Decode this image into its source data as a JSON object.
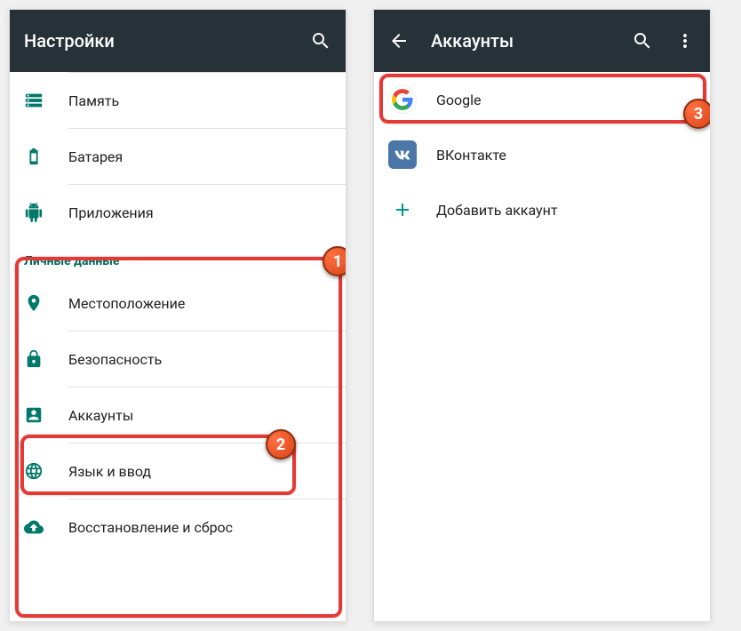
{
  "left": {
    "title": "Настройки",
    "items_top": [
      {
        "label": "Память",
        "icon": "storage"
      },
      {
        "label": "Батарея",
        "icon": "battery"
      },
      {
        "label": "Приложения",
        "icon": "apps"
      }
    ],
    "section_header": "Личные данные",
    "items_personal": [
      {
        "label": "Местоположение",
        "icon": "location"
      },
      {
        "label": "Безопасность",
        "icon": "lock"
      },
      {
        "label": "Аккаунты",
        "icon": "accounts"
      },
      {
        "label": "Язык и ввод",
        "icon": "language"
      },
      {
        "label": "Восстановление и сброс",
        "icon": "backup"
      }
    ]
  },
  "right": {
    "title": "Аккаунты",
    "accounts": [
      {
        "label": "Google",
        "type": "google"
      },
      {
        "label": "ВКонтакте",
        "type": "vk"
      }
    ],
    "add_label": "Добавить аккаунт"
  },
  "badges": {
    "b1": "1",
    "b2": "2",
    "b3": "3"
  }
}
